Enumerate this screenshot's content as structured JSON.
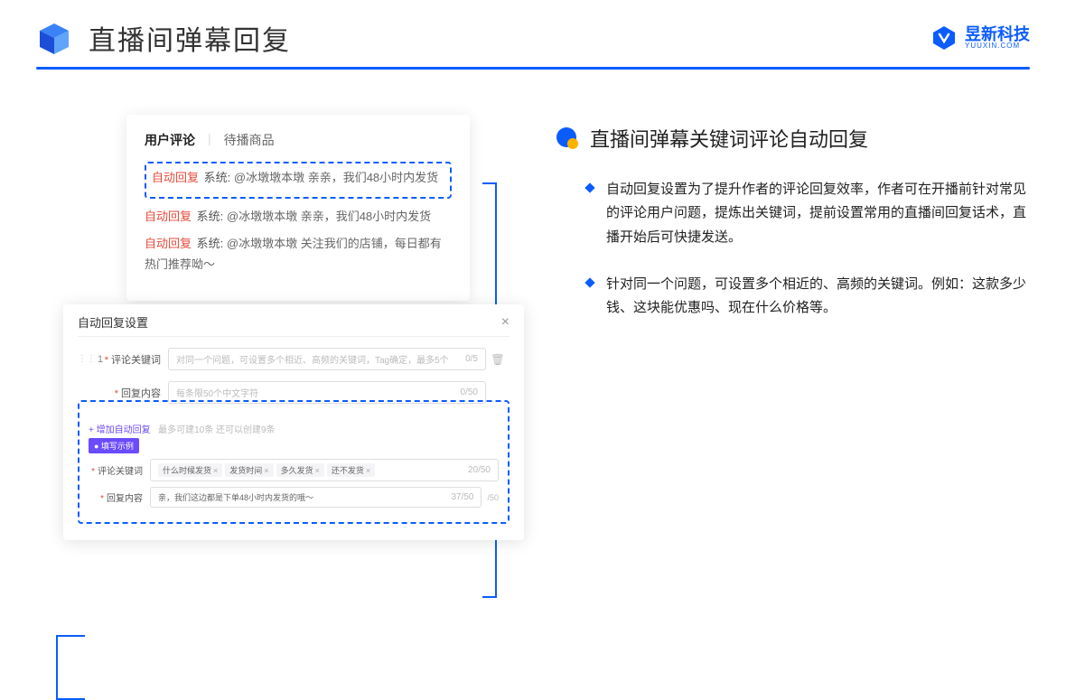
{
  "header": {
    "title": "直播间弹幕回复",
    "logo_text": "昱新科技",
    "logo_sub": "YUUXIN.COM"
  },
  "comments": {
    "tab_active": "用户评论",
    "tab_inactive": "待播商品",
    "row1_tag": "自动回复",
    "row1_sys": "系统:",
    "row1_text": "@冰墩墩本墩 亲亲，我们48小时内发货",
    "row2_tag": "自动回复",
    "row2_sys": "系统:",
    "row2_text": "@冰墩墩本墩 亲亲，我们48小时内发货",
    "row3_tag": "自动回复",
    "row3_sys": "系统:",
    "row3_text": "@冰墩墩本墩 关注我们的店铺，每日都有热门推荐呦～"
  },
  "settings": {
    "title": "自动回复设置",
    "num": "1",
    "label_keyword": "评论关键词",
    "keyword_placeholder": "对同一个问题，可设置多个相近、高频的关键词，Tag确定，最多5个",
    "keyword_count": "0/5",
    "label_reply": "回复内容",
    "reply_placeholder": "每条限50个中文字符",
    "reply_count": "0/50",
    "add_link": "+ 增加自动回复",
    "add_hint": "最多可建10条 还可以创建9条",
    "example_badge": "● 填写示例",
    "ex_label_kw": "评论关键词",
    "ex_kw1": "什么时候发货",
    "ex_kw2": "发货时间",
    "ex_kw3": "多久发货",
    "ex_kw4": "还不发货",
    "ex_kw_count": "20/50",
    "ex_label_reply": "回复内容",
    "ex_reply_text": "亲，我们这边都是下单48小时内发货的哦～",
    "ex_reply_count": "37/50",
    "side_count": "/50"
  },
  "right": {
    "subtitle": "直播间弹幕关键词评论自动回复",
    "para1": "自动回复设置为了提升作者的评论回复效率，作者可在开播前针对常见的评论用户问题，提炼出关键词，提前设置常用的直播间回复话术，直播开始后可快捷发送。",
    "para2": "针对同一个问题，可设置多个相近的、高频的关键词。例如：这款多少钱、这块能优惠吗、现在什么价格等。"
  }
}
